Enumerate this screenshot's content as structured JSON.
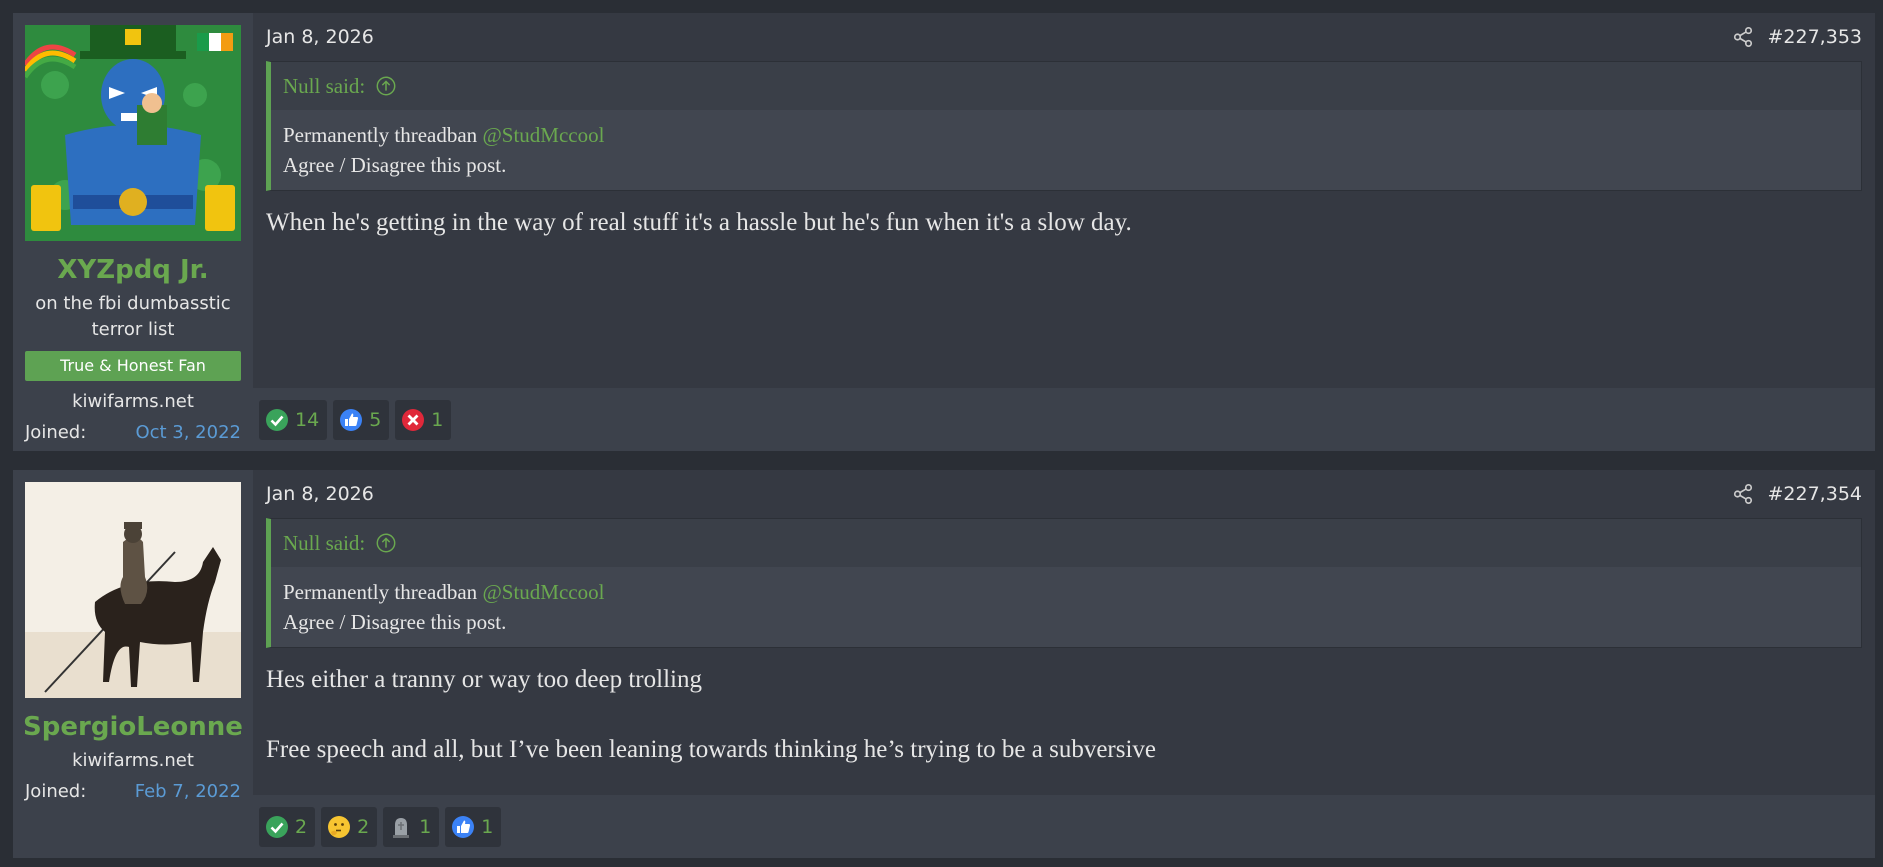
{
  "posts": [
    {
      "user": {
        "name": "XYZpdq Jr.",
        "title": "on the fbi dumbasstic terror list",
        "banner": "True & Honest Fan",
        "site": "kiwifarms.net",
        "joined_label": "Joined:",
        "joined_date": "Oct 3, 2022"
      },
      "date": "Jan 8, 2026",
      "post_number": "#227,353",
      "quote": {
        "author": "Null said:",
        "text": "Permanently threadban",
        "mention": "@StudMccool",
        "line2": "Agree / Disagree this post."
      },
      "body": [
        "When he's getting in the way of real stuff it's a hassle but he's fun when it's a slow day."
      ],
      "reactions": [
        {
          "icon": "checkmark-icon",
          "count": "14"
        },
        {
          "icon": "thumbs-up-icon",
          "count": "5"
        },
        {
          "icon": "x-mark-icon",
          "count": "1"
        }
      ]
    },
    {
      "user": {
        "name": "SpergioLeonne",
        "site": "kiwifarms.net",
        "joined_label": "Joined:",
        "joined_date": "Feb 7, 2022"
      },
      "date": "Jan 8, 2026",
      "post_number": "#227,354",
      "quote": {
        "author": "Null said:",
        "text": "Permanently threadban",
        "mention": "@StudMccool",
        "line2": "Agree / Disagree this post."
      },
      "body": [
        "Hes either a tranny or way too deep trolling",
        "Free speech and all, but I’ve been leaning towards thinking he’s trying to be a subversive"
      ],
      "reactions": [
        {
          "icon": "checkmark-icon",
          "count": "2"
        },
        {
          "icon": "thinking-face-icon",
          "count": "2"
        },
        {
          "icon": "gravestone-icon",
          "count": "1"
        },
        {
          "icon": "thumbs-up-icon",
          "count": "1"
        }
      ]
    }
  ],
  "colors": {
    "accent_green": "#6aa84f",
    "link_blue": "#5b9bd5",
    "page_bg": "#2a2e35"
  }
}
